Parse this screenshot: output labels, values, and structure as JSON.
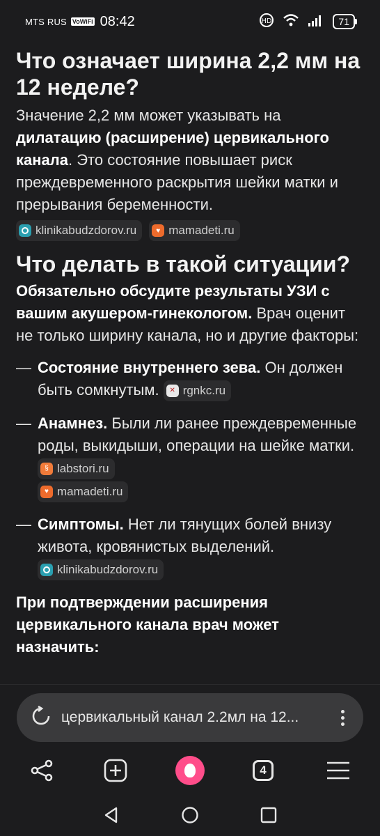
{
  "status_bar": {
    "carrier": "MTS RUS",
    "vowifi": "VoWiFi",
    "time": "08:42",
    "battery": "71"
  },
  "article": {
    "heading1": "Что означает ширина 2,2 мм на 12 неделе?",
    "para1": {
      "part1": "Значение 2,2 мм может указывать на ",
      "bold": "дилатацию (расширение) цервикального канала",
      "part2": ". Это состояние повышает риск преждевременного раскрытия шейки матки и прерывания беременности."
    },
    "sources1": [
      {
        "label": "klinikabudzdorov.ru",
        "icon": "klinika-icon"
      },
      {
        "label": "mamadeti.ru",
        "icon": "mamadeti-icon"
      }
    ],
    "heading2": "Что делать в такой ситуации?",
    "para2": {
      "bold": "Обязательно обсудите результаты УЗИ с вашим акушером-гинекологом.",
      "part": " Врач оценит не только ширину канала, но и другие факторы:"
    },
    "list": [
      {
        "dash": "—",
        "bold": "Состояние внутреннего зева.",
        "text": " Он должен быть сомкнутым. ",
        "sources": [
          {
            "label": "rgnkc.ru",
            "icon": "rgnkc-icon"
          }
        ]
      },
      {
        "dash": "—",
        "bold": "Анамнез.",
        "text": " Были ли ранее преждевременные роды, выкидыши, операции на шейке матки. ",
        "sources": [
          {
            "label": "labstori.ru",
            "icon": "labstori-icon"
          },
          {
            "label": "mamadeti.ru",
            "icon": "mamadeti-icon"
          }
        ]
      },
      {
        "dash": "—",
        "bold": "Симптомы.",
        "text": " Нет ли тянущих болей внизу живота, кровянистых выделений. ",
        "sources": [
          {
            "label": "klinikabudzdorov.ru",
            "icon": "klinika-icon"
          }
        ]
      }
    ],
    "closing": "При подтверждении расширения цервикального канала врач может назначить:"
  },
  "search": {
    "query": "цервикальный канал 2.2мл на 12..."
  },
  "toolbar": {
    "tabs_count": "4"
  }
}
